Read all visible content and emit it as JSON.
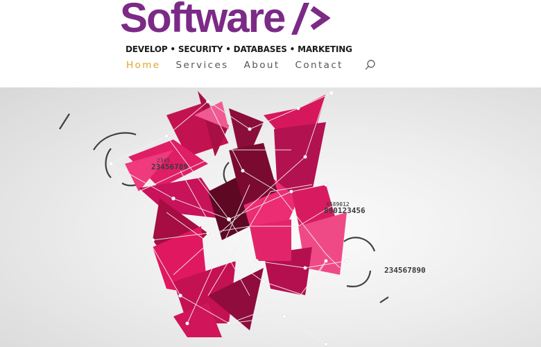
{
  "brand": {
    "name": "Software",
    "tagline": "DEVELOP • SECURITY • DATABASES • MARKETING",
    "color": "#7b2a86"
  },
  "nav": {
    "items": [
      {
        "label": "Home",
        "active": true
      },
      {
        "label": "Services",
        "active": false
      },
      {
        "label": "About",
        "active": false
      },
      {
        "label": "Contact",
        "active": false
      }
    ],
    "search_icon": "search-icon",
    "active_color": "#e0a526"
  },
  "hero": {
    "numbers": [
      "2345",
      "23456789",
      "4589012",
      "890123456",
      "234567890"
    ],
    "accent_color": "#d6175c"
  }
}
